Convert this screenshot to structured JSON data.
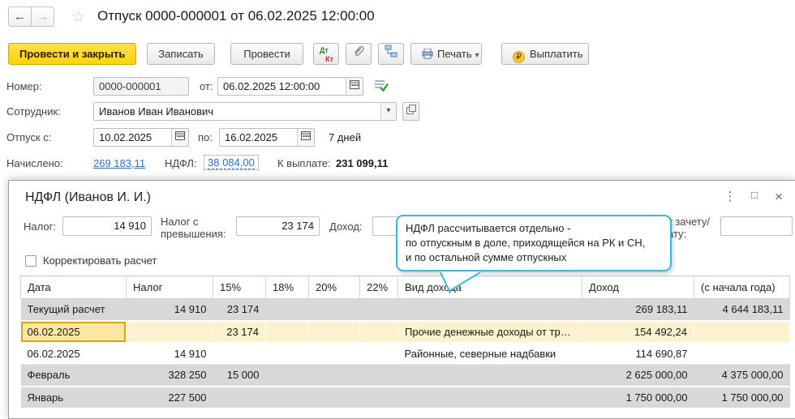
{
  "window": {
    "title": "Отпуск 0000-000001 от 06.02.2025 12:00:00"
  },
  "icons": {
    "back_glyph": "←",
    "forward_glyph": "→",
    "star_glyph": "☆",
    "dropdown_glyph": "▾",
    "menu_glyph": "⋮",
    "maximize_glyph": "□",
    "close_glyph": "×",
    "ruble_glyph": "₽",
    "dt_label": "Дт",
    "kt_label": "Кт"
  },
  "colors": {
    "accent_yellow": "#ffd20a",
    "link_blue": "#2f6fc0",
    "tooltip_border": "#3bb8d8",
    "row_grey": "#d8d8d8",
    "row_yellow": "#fcf2ce",
    "selected_cell_border": "#dfa400"
  },
  "toolbar": {
    "post_and_close": "Провести и закрыть",
    "save": "Записать",
    "post": "Провести",
    "print": "Печать",
    "pay": "Выплатить"
  },
  "form": {
    "number_label": "Номер:",
    "number_value": "0000-000001",
    "from_label": "от:",
    "datetime_value": "06.02.2025 12:00:00",
    "employee_label": "Сотрудник:",
    "employee_value": "Иванов Иван Иванович",
    "vacation_from_label": "Отпуск с:",
    "vacation_from": "10.02.2025",
    "vacation_to_label": "по:",
    "vacation_to": "16.02.2025",
    "days": "7 дней",
    "accrued_label": "Начислено:",
    "accrued_value": "269 183,11",
    "ndfl_label": "НДФЛ:",
    "ndfl_value": "38 084,00",
    "payout_label": "К выплате:",
    "payout_value": "231 099,11"
  },
  "popup": {
    "title": "НДФЛ (Иванов И. И.)",
    "fields": {
      "tax_label": "Налог:",
      "tax_value": "14 910",
      "excess_label_line1": "Налог с",
      "excess_label_line2": "превышения:",
      "excess_value": "23 174",
      "income_label": "Доход:",
      "offset_label_line1": "к зачету/",
      "offset_label_line2": "ату:"
    },
    "checkbox_label": "Корректировать расчет",
    "tooltip": [
      "НДФЛ рассчитывается отдельно -",
      "по отпускным в доле, приходящейся на РК и СН,",
      "и по остальной сумме отпускных"
    ],
    "table": {
      "headers": [
        "Дата",
        "Налог",
        "15%",
        "18%",
        "20%",
        "22%",
        "Вид дохода",
        "Доход",
        "(с начала года)"
      ],
      "rows": [
        {
          "style": "grey",
          "cells": [
            "Текущий расчет",
            "14 910",
            "23 174",
            "",
            "",
            "",
            "",
            "269 183,11",
            "4 644 183,11"
          ]
        },
        {
          "style": "yellow",
          "selected_cell": 0,
          "cells": [
            "06.02.2025",
            "",
            "23 174",
            "",
            "",
            "",
            "Прочие денежные доходы от тр…",
            "154 492,24",
            ""
          ]
        },
        {
          "style": "white",
          "cells": [
            "06.02.2025",
            "14 910",
            "",
            "",
            "",
            "",
            "Районные, северные надбавки",
            "114 690,87",
            ""
          ]
        },
        {
          "style": "grey",
          "cells": [
            "Февраль",
            "328 250",
            "15 000",
            "",
            "",
            "",
            "",
            "2 625 000,00",
            "4 375 000,00"
          ]
        },
        {
          "style": "grey",
          "cells": [
            "Январь",
            "227 500",
            "",
            "",
            "",
            "",
            "",
            "1 750 000,00",
            "1 750 000,00"
          ]
        }
      ]
    }
  }
}
